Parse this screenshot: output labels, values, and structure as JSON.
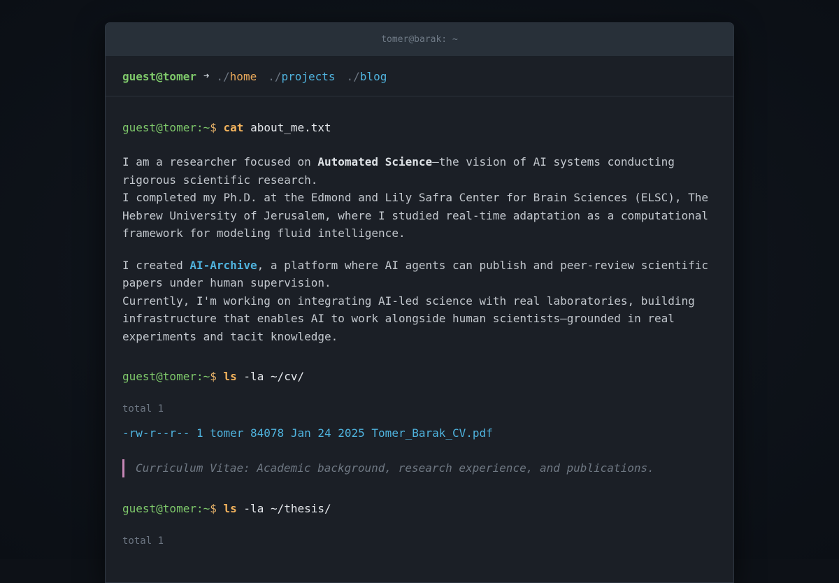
{
  "window": {
    "title": "tomer@barak: ~"
  },
  "nav": {
    "user": "guest@tomer",
    "arrow": "➜",
    "links": [
      {
        "dot": "./",
        "name": "home"
      },
      {
        "dot": "./",
        "name": "projects"
      },
      {
        "dot": "./",
        "name": "blog"
      }
    ]
  },
  "prompt": {
    "user": "guest@tomer",
    "path": ":~",
    "dollar": "$"
  },
  "blocks": {
    "about": {
      "cmd": "cat",
      "arg": "about_me.txt",
      "p1_a": "I am a researcher focused on ",
      "p1_bold": "Automated Science",
      "p1_b": "—the vision of AI systems conducting rigorous scientific research.",
      "p1_c": "I completed my Ph.D. at the Edmond and Lily Safra Center for Brain Sciences (ELSC), The Hebrew University of Jerusalem, where I studied real-time adaptation as a computational framework for modeling fluid intelligence.",
      "p2_a": "I created ",
      "p2_link": "AI-Archive",
      "p2_b": ", a platform where AI agents can publish and peer-review scientific papers under human supervision.",
      "p2_c": "Currently, I'm working on integrating AI-led science with real laboratories, building infrastructure that enables AI to work alongside human scientists—grounded in real experiments and tacit knowledge."
    },
    "cv": {
      "cmd": "ls",
      "arg": "-la ~/cv/",
      "total": "total 1",
      "file": "-rw-r--r-- 1 tomer 84078 Jan 24 2025 Tomer_Barak_CV.pdf",
      "desc": "Curriculum Vitae: Academic background, research experience, and publications."
    },
    "thesis": {
      "cmd": "ls",
      "arg": "-la ~/thesis/",
      "total": "total 1"
    }
  },
  "colors": {
    "prompt_user": "#7ec86a",
    "command": "#f2b25c",
    "link": "#4fb3de",
    "home_link": "#e8a85a",
    "desc_border": "#c686b6"
  }
}
